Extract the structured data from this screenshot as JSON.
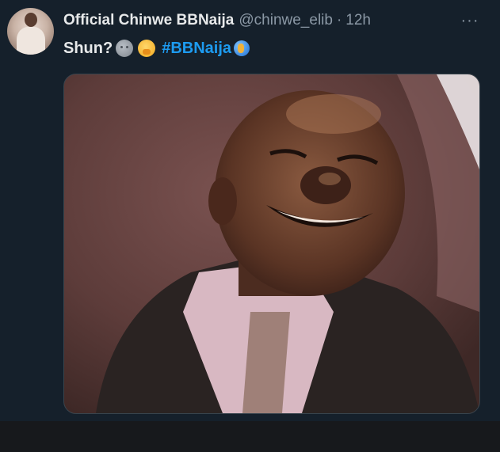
{
  "tweet": {
    "author_name": "Official Chinwe BBNaija",
    "handle": "@chinwe_elib",
    "separator": "·",
    "time": "12h",
    "more_label": "···",
    "text": "Shun?",
    "emojis": [
      "new-moon-face",
      "face-with-hand-over-mouth",
      "globe"
    ],
    "hashtag": "#BBNaija"
  },
  "media": {
    "description_icon": "photo-of-smiling-man"
  },
  "colors": {
    "background": "#15202b",
    "text_primary": "#e7e9ea",
    "text_secondary": "#8b98a5",
    "link": "#1d9bf0"
  }
}
